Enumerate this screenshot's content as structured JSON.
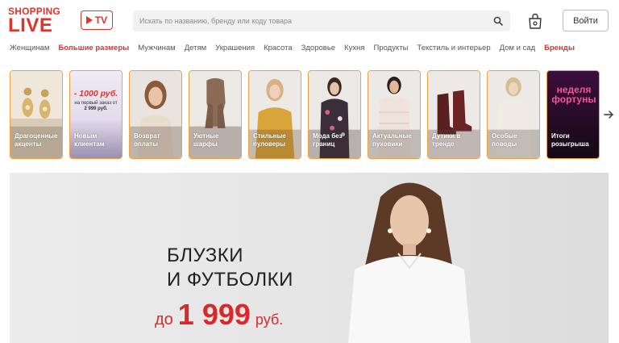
{
  "header": {
    "logo_line1": "SHOPPING",
    "logo_line2": "LIVE",
    "tv_label": "TV",
    "search_placeholder": "Искать по названию, бренду или коду товара",
    "login_label": "Войти"
  },
  "nav": {
    "items": [
      {
        "label": "Женщинам",
        "accent": false
      },
      {
        "label": "Большие размеры",
        "accent": true
      },
      {
        "label": "Мужчинам",
        "accent": false
      },
      {
        "label": "Детям",
        "accent": false
      },
      {
        "label": "Украшения",
        "accent": false
      },
      {
        "label": "Красота",
        "accent": false
      },
      {
        "label": "Здоровье",
        "accent": false
      },
      {
        "label": "Кухня",
        "accent": false
      },
      {
        "label": "Продукты",
        "accent": false
      },
      {
        "label": "Текстиль и интерьер",
        "accent": false
      },
      {
        "label": "Дом и сад",
        "accent": false
      },
      {
        "label": "Бренды",
        "accent": true
      }
    ]
  },
  "stories": [
    {
      "caption": "Драгоценные акценты",
      "icon": "earrings"
    },
    {
      "caption": "Новым клиентам",
      "icon": "promo",
      "promo_big": "- 1000 руб.",
      "promo_small": "на первый заказ от",
      "promo_bold": "2 999 руб."
    },
    {
      "caption": "Возврат оплаты",
      "icon": "woman-smiling"
    },
    {
      "caption": "Уютные шарфы",
      "icon": "scarf"
    },
    {
      "caption": "Стильные пуловеры",
      "icon": "yellow-pullover"
    },
    {
      "caption": "Мода без границ",
      "icon": "floral-blouse"
    },
    {
      "caption": "Актуальные пуховики",
      "icon": "puffer-jacket"
    },
    {
      "caption": "Дутики в тренде",
      "icon": "boots"
    },
    {
      "caption": "Особые поводы",
      "icon": "white-sweater"
    },
    {
      "caption": "Итоги розыгрыша",
      "icon": "nedelya-fortuny",
      "promo_big": "неделя фортуны"
    }
  ],
  "banner": {
    "title": "БЛУЗКИ\nИ ФУТБОЛКИ",
    "price_prefix": "до",
    "price_amount": "1 999",
    "price_currency": "руб."
  },
  "colors": {
    "brand_red": "#e2322a",
    "story_border": "#f1a144",
    "price_red": "#d92a2a"
  }
}
